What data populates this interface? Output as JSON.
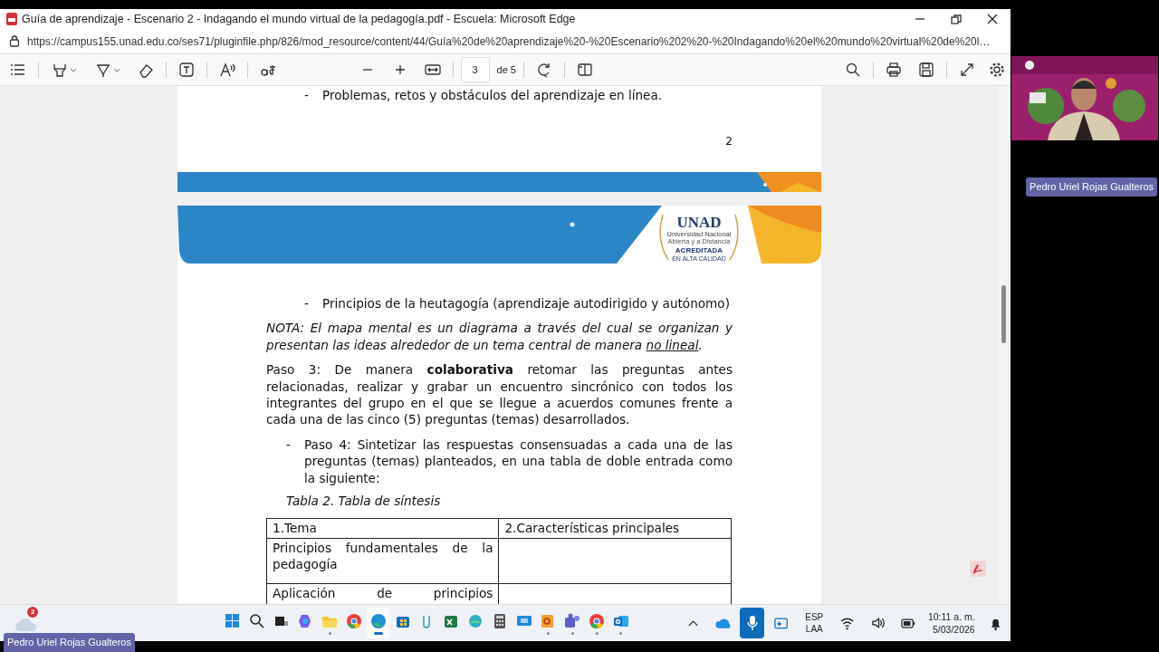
{
  "window": {
    "title": "Guía de aprendizaje - Escenario 2 - Indagando el mundo virtual de la pedagogía.pdf - Escuela: Microsoft Edge"
  },
  "address_bar": {
    "url": "https://campus155.unad.edu.co/ses71/pluginfile.php/826/mod_resource/content/44/Guía%20de%20aprendizaje%20-%20Escenario%202%20-%20Indagando%20el%20mundo%20virtual%20de%20l…"
  },
  "pdf_toolbar": {
    "page": "3",
    "page_count": "de 5"
  },
  "document": {
    "previous_page": {
      "blocks": [
        {
          "kind": "subitem",
          "marker": "-",
          "text": "Problemas, retos y obstáculos del aprendizaje en línea."
        }
      ],
      "page_number": "2"
    },
    "banner": {
      "logo": "UNAD",
      "logo_lines": [
        "Universidad Nacional",
        "Abierta y a Distancia"
      ],
      "seal": "ACREDITADA",
      "seal_sub": "EN ALTA CALIDAD"
    },
    "blocks": [
      {
        "kind": "subitem",
        "marker": "-",
        "text": "Principios de la heutagogía (aprendizaje autodirigido y autónomo)"
      },
      {
        "kind": "note",
        "segments": [
          {
            "text": "NOTA: El mapa mental es un diagrama a través del cual se organizan y presentan las ideas alrededor de un tema central de manera ",
            "underline": false
          },
          {
            "text": "no lineal",
            "underline": true
          },
          {
            "text": ".",
            "underline": false
          }
        ]
      },
      {
        "kind": "paragraph",
        "text": "Paso 3: De manera **colaborativa** retomar las preguntas antes relacionadas, realizar y grabar un encuentro sincrónico con todos los integrantes del grupo en el que se llegue a acuerdos comunes frente a cada una de las cinco (5) preguntas (temas) desarrollados."
      },
      {
        "kind": "item",
        "marker": "-",
        "text": "Paso 4: Sintetizar las respuestas consensuadas a cada una de las preguntas (temas) planteados, en una tabla de doble entrada como la siguiente:"
      },
      {
        "kind": "caption",
        "text": "Tabla 2. Tabla de síntesis"
      }
    ],
    "table": {
      "columns": [
        "1.Tema",
        "2.Características principales"
      ],
      "rows": [
        {
          "cells": [
            "Principios fundamentales de la pedagogía"
          ]
        },
        {
          "cells": [
            "Aplicación de principios"
          ]
        }
      ]
    }
  },
  "taskbar": {
    "notification_count": "2",
    "apps": [
      {
        "kind": "start",
        "running": false,
        "selected": false
      },
      {
        "kind": "search",
        "running": false,
        "selected": false
      },
      {
        "kind": "taskview",
        "running": false,
        "selected": false
      },
      {
        "kind": "copilot",
        "running": false,
        "selected": false
      },
      {
        "kind": "explorer",
        "running": true,
        "selected": false
      },
      {
        "kind": "chrome",
        "running": false,
        "selected": false
      },
      {
        "kind": "edge",
        "running": true,
        "selected": true
      },
      {
        "kind": "store",
        "running": false,
        "selected": false
      },
      {
        "kind": "clip",
        "running": false,
        "selected": false
      },
      {
        "kind": "sheet",
        "running": false,
        "selected": false
      },
      {
        "kind": "globe",
        "running": false,
        "selected": false
      },
      {
        "kind": "calculator",
        "running": false,
        "selected": false
      },
      {
        "kind": "remote",
        "running": false,
        "selected": false
      },
      {
        "kind": "viewer",
        "running": true,
        "selected": false
      },
      {
        "kind": "teams",
        "running": true,
        "selected": false
      },
      {
        "kind": "chrome",
        "running": true,
        "selected": false
      },
      {
        "kind": "outlook",
        "running": true,
        "selected": false
      }
    ],
    "microphone": {
      "selected": true
    },
    "language": [
      "ESP",
      "LAA"
    ],
    "time": "10:11 a. m.",
    "date": "5/03/2026"
  },
  "meeting": {
    "participant": "Pedro Uriel Rojas Gualteros",
    "presenter": "Pedro Uriel Rojas Gualteros"
  }
}
